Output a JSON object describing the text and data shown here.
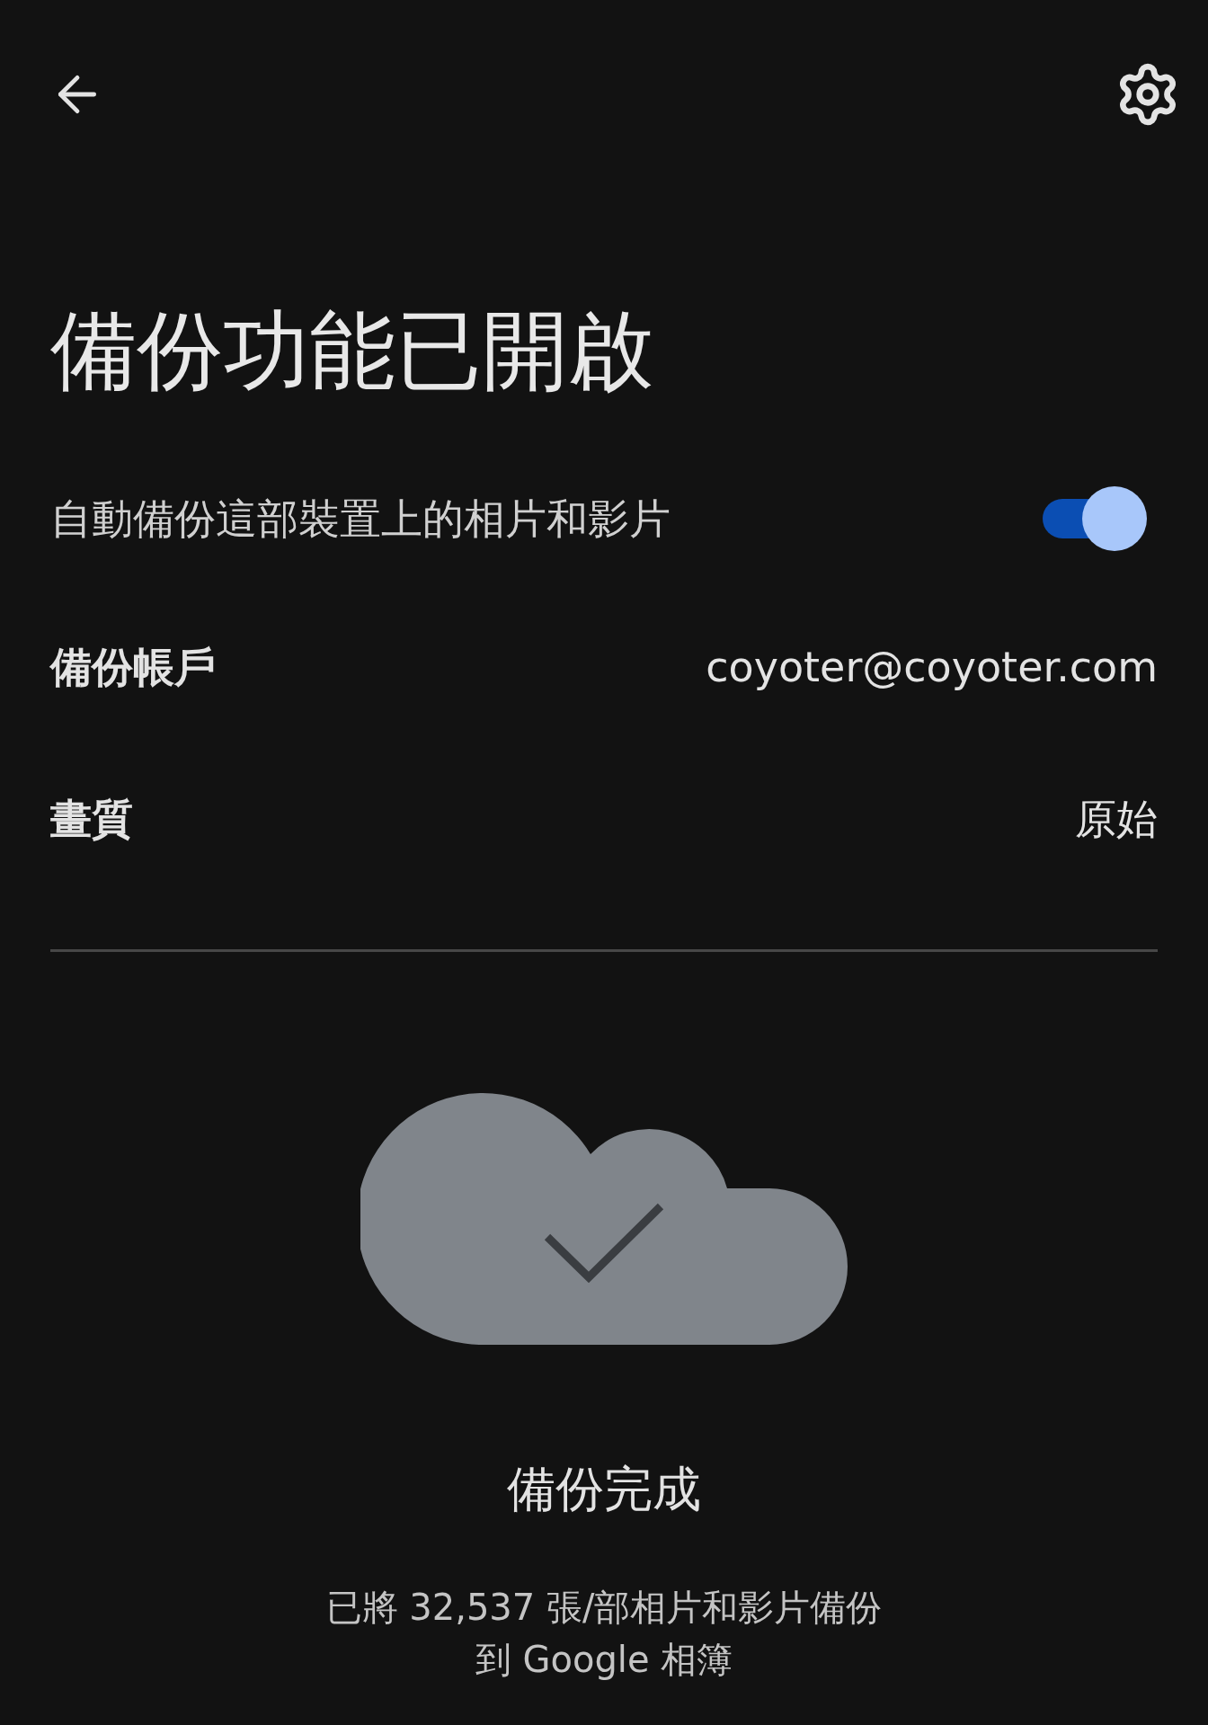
{
  "title": "備份功能已開啟",
  "auto_backup": {
    "label": "自動備份這部裝置上的相片和影片",
    "on": true
  },
  "rows": [
    {
      "label": "備份帳戶",
      "value": "coyoter@coyoter.com"
    },
    {
      "label": "畫質",
      "value": "原始"
    }
  ],
  "status": {
    "title": "備份完成",
    "description_lines": [
      "已將 32,537 張/部相片和影片備份",
      "到 Google 相簿"
    ]
  }
}
